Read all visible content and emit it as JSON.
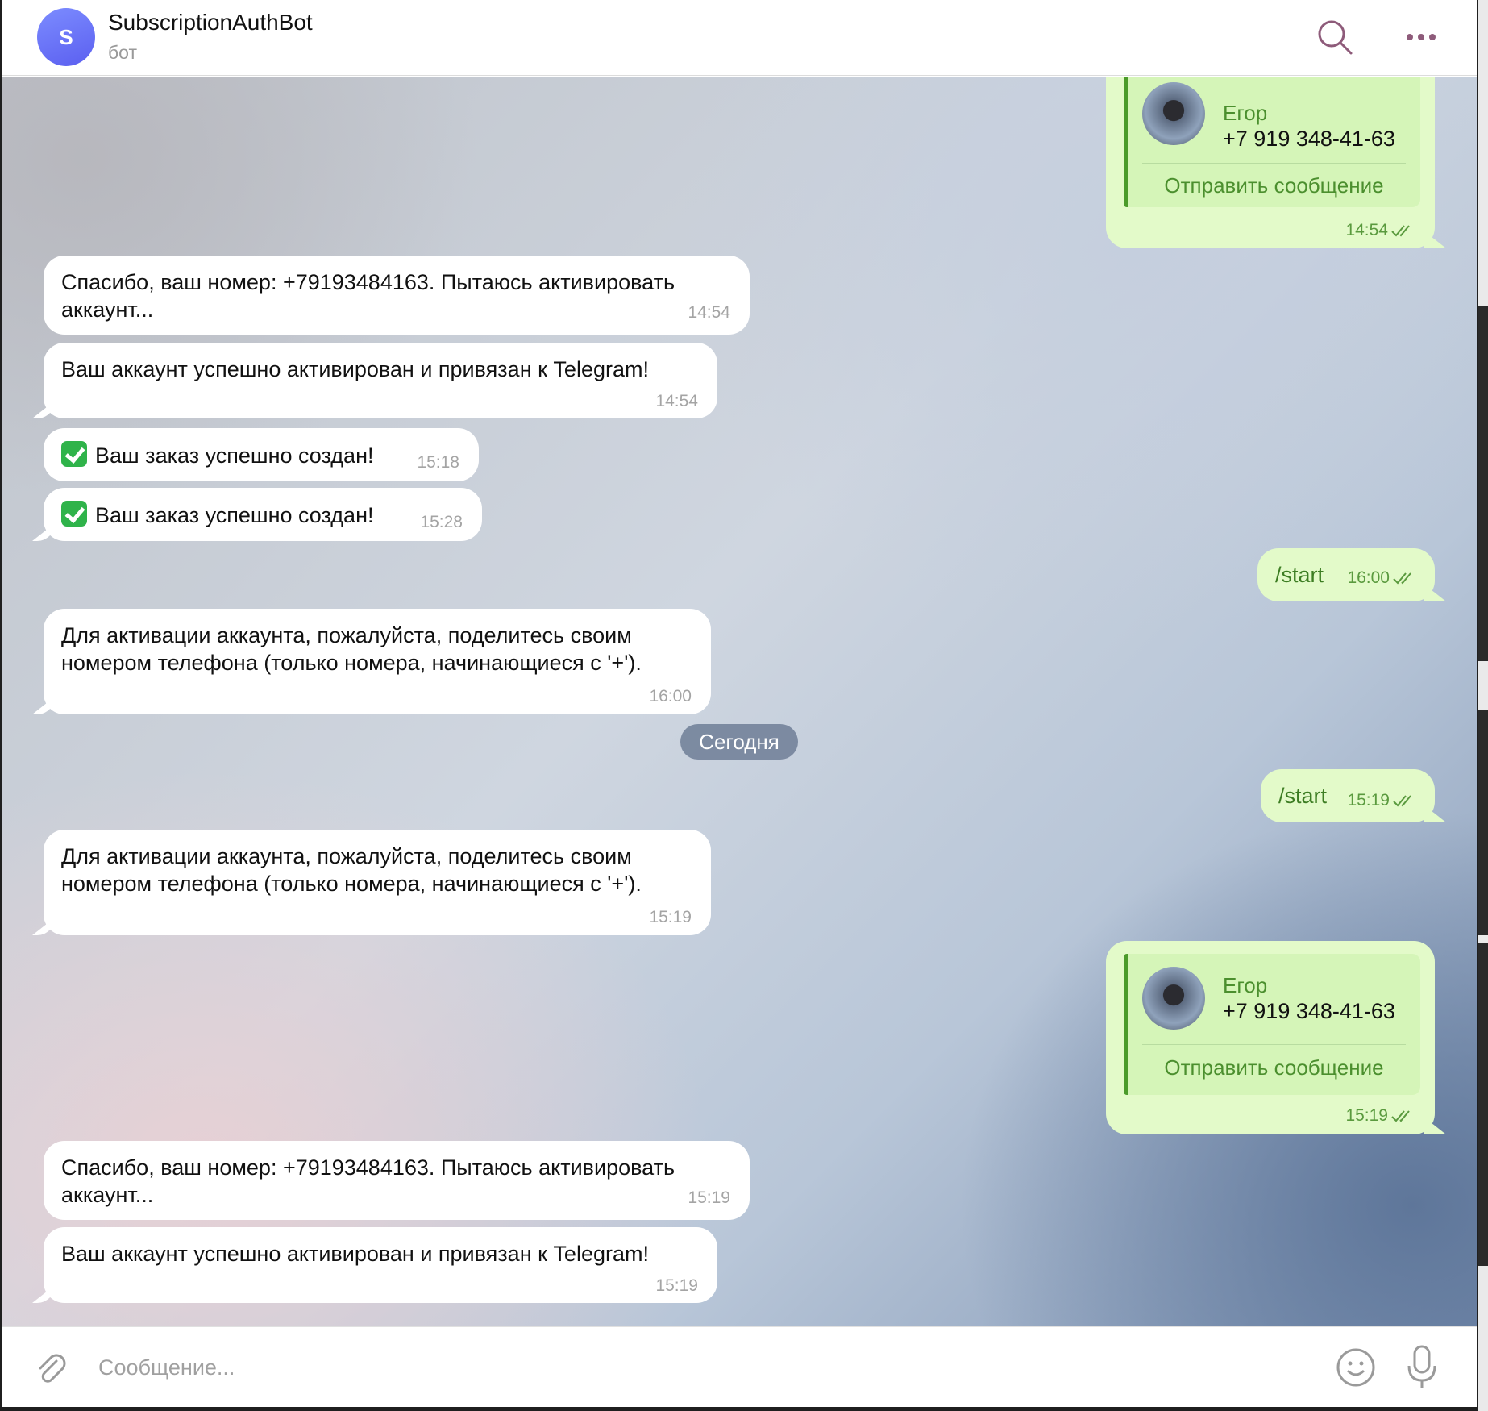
{
  "header": {
    "avatar_letter": "S",
    "title": "SubscriptionAuthBot",
    "subtitle": "бот",
    "icons": [
      "search-icon",
      "more-icon"
    ]
  },
  "date_separator": "Сегодня",
  "contact_card": {
    "name": "Егор",
    "phone": "+7 919 348-41-63",
    "action": "Отправить сообщение"
  },
  "messages": [
    {
      "dir": "out",
      "type": "contact",
      "time": "14:54"
    },
    {
      "dir": "in",
      "text": "Спасибо, ваш номер: +79193484163. Пытаюсь активировать\nаккаунт...",
      "time": "14:54"
    },
    {
      "dir": "in",
      "text": "Ваш аккаунт успешно активирован и привязан к Telegram!",
      "time": "14:54"
    },
    {
      "dir": "in",
      "text": "Ваш заказ успешно создан!",
      "emoji": "check-mark-emoji",
      "time": "15:18"
    },
    {
      "dir": "in",
      "text": "Ваш заказ успешно создан!",
      "emoji": "check-mark-emoji",
      "time": "15:28"
    },
    {
      "dir": "out",
      "text": "/start",
      "time": "16:00"
    },
    {
      "dir": "in",
      "text": "Для активации аккаунта, пожалуйста, поделитесь своим\nномером телефона (только номера, начинающиеся с '+').",
      "time": "16:00"
    },
    {
      "dir": "out",
      "text": "/start",
      "time": "15:19"
    },
    {
      "dir": "in",
      "text": "Для активации аккаунта, пожалуйста, поделитесь своим\nномером телефона (только номера, начинающиеся с '+').",
      "time": "15:19"
    },
    {
      "dir": "out",
      "type": "contact",
      "time": "15:19"
    },
    {
      "dir": "in",
      "text": "Спасибо, ваш номер: +79193484163. Пытаюсь активировать\nаккаунт...",
      "time": "15:19"
    },
    {
      "dir": "in",
      "text": "Ваш аккаунт успешно активирован и привязан к Telegram!",
      "time": "15:19"
    }
  ],
  "composer": {
    "placeholder": "Сообщение...",
    "icons": [
      "attach-icon",
      "emoji-icon",
      "microphone-icon"
    ]
  },
  "colors": {
    "incoming_bubble": "#ffffff",
    "outgoing_bubble": "#e3fac9",
    "outgoing_text": "#3d7d23",
    "accent_avatar": "#6b6ff5"
  }
}
